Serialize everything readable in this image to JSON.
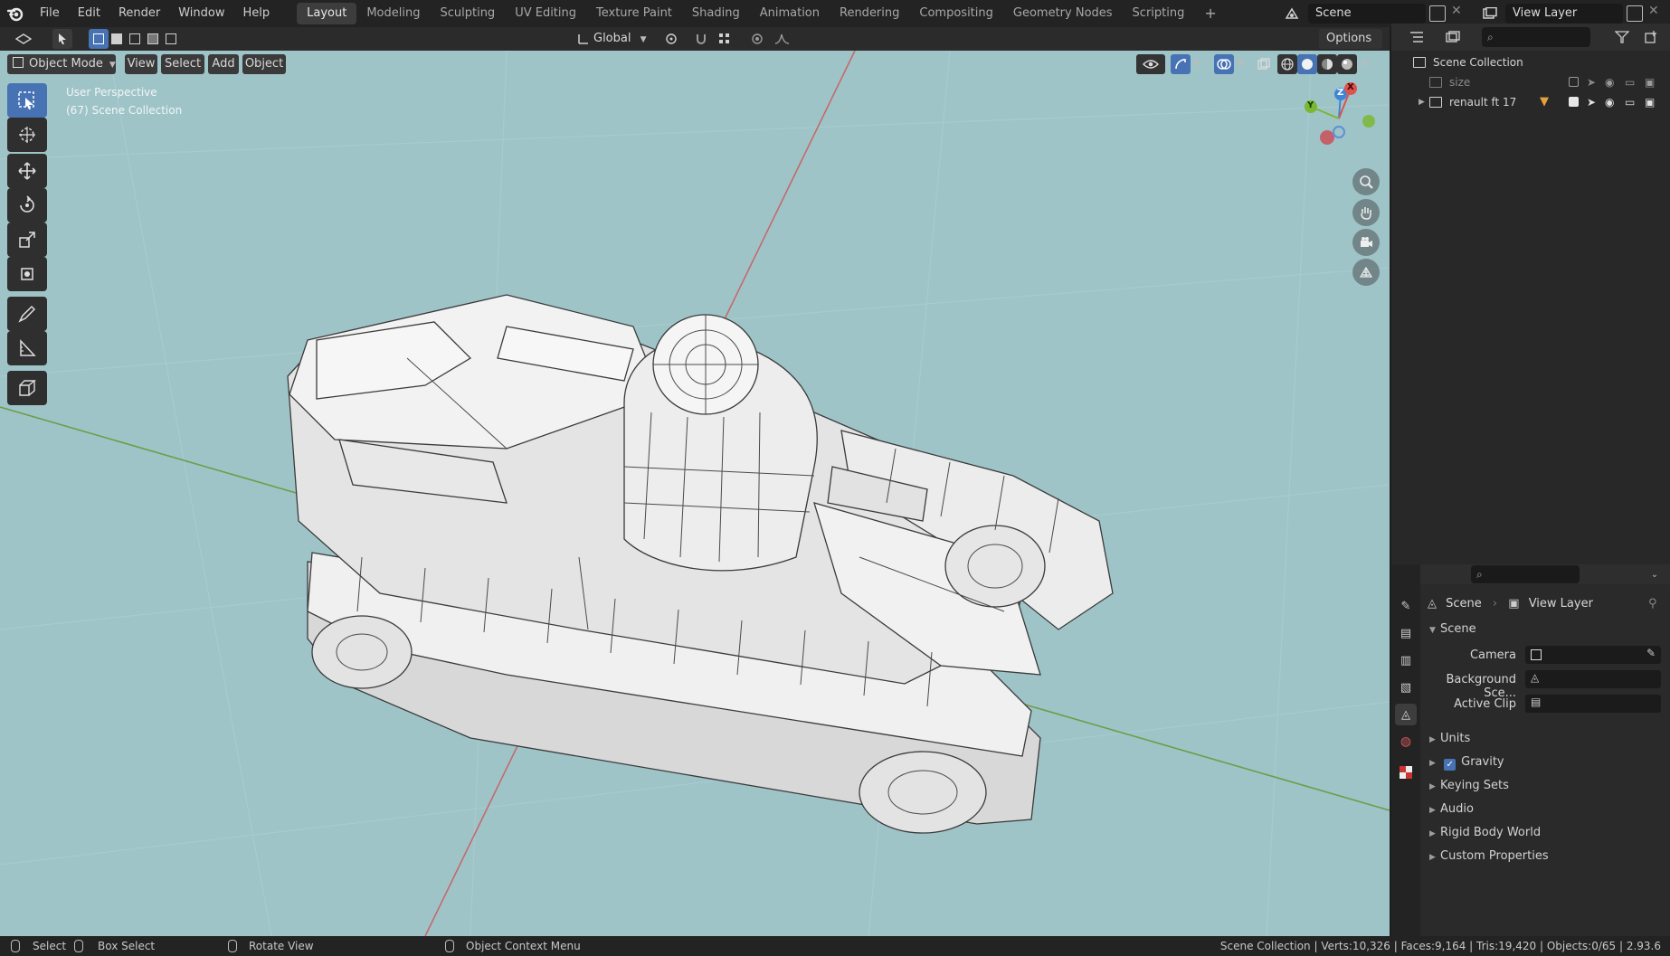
{
  "menu": {
    "items": [
      "File",
      "Edit",
      "Render",
      "Window",
      "Help"
    ]
  },
  "workspaces": {
    "tabs": [
      "Layout",
      "Modeling",
      "Sculpting",
      "UV Editing",
      "Texture Paint",
      "Shading",
      "Animation",
      "Rendering",
      "Compositing",
      "Geometry Nodes",
      "Scripting"
    ],
    "active": "Layout",
    "add_label": "+"
  },
  "scene_selector": {
    "value": "Scene"
  },
  "view_layer_selector": {
    "value": "View Layer"
  },
  "viewport_header": {
    "mode": "Object Mode",
    "menus": [
      "View",
      "Select",
      "Add",
      "Object"
    ],
    "transform_orientation": "Global",
    "options_label": "Options"
  },
  "viewport": {
    "perspective_label": "User Perspective",
    "collection_label": "(67) Scene Collection",
    "gizmo_axes": {
      "x": "X",
      "y": "Y",
      "z": "Z"
    },
    "background_color": "#9fc4c8"
  },
  "outliner": {
    "root": "Scene Collection",
    "items": [
      {
        "label": "size",
        "disabled": true
      },
      {
        "label": "renault ft 17",
        "disabled": false
      }
    ],
    "search_placeholder": ""
  },
  "properties": {
    "breadcrumb": {
      "scene": "Scene",
      "view_layer": "View Layer"
    },
    "panel_title": "Scene",
    "fields": [
      {
        "label": "Camera",
        "value": ""
      },
      {
        "label": "Background Sce...",
        "value": ""
      },
      {
        "label": "Active Clip",
        "value": ""
      }
    ],
    "subpanels": [
      "Units",
      "Gravity",
      "Keying Sets",
      "Audio",
      "Rigid Body World",
      "Custom Properties"
    ],
    "gravity_checked": true
  },
  "status_bar": {
    "select": "Select",
    "box_select": "Box Select",
    "rotate_view": "Rotate View",
    "context_menu": "Object Context Menu",
    "stats": "Scene Collection | Verts:10,326 | Faces:9,164 | Tris:19,420 | Objects:0/65 | 2.93.6"
  },
  "colors": {
    "accent": "#4772b3",
    "axis_x": "#d9534f",
    "axis_y": "#7ab833",
    "axis_z": "#3d85d8"
  }
}
